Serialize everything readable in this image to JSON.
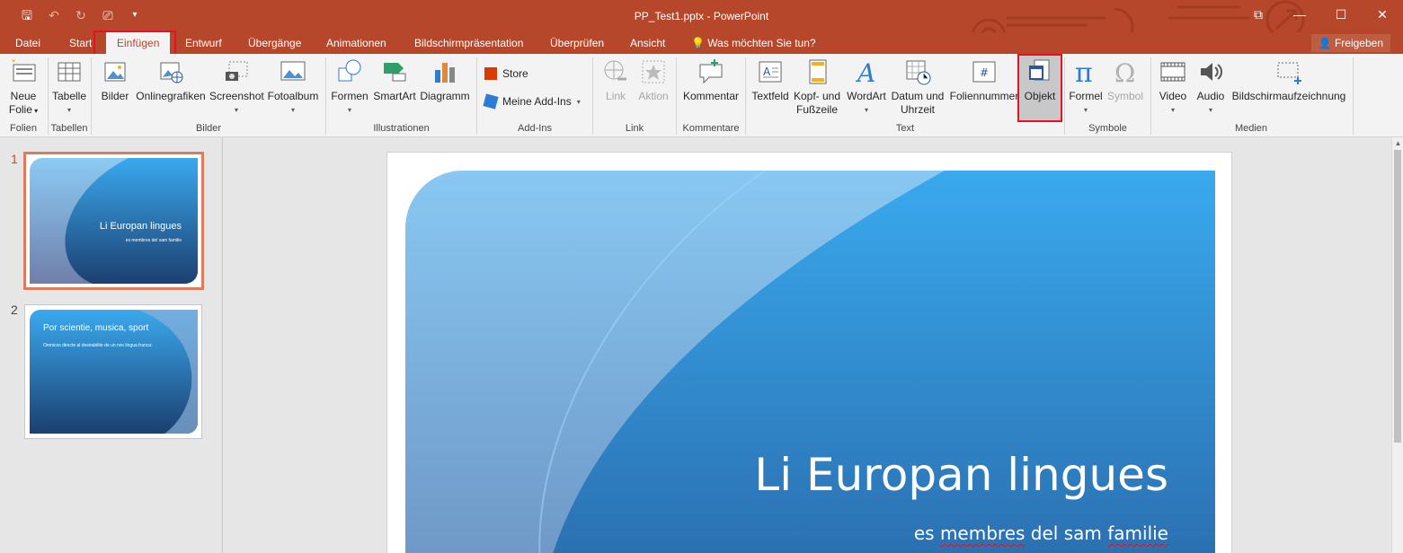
{
  "window": {
    "title": "PP_Test1.pptx - PowerPoint"
  },
  "tabs": [
    "Datei",
    "Start",
    "Einfügen",
    "Entwurf",
    "Übergänge",
    "Animationen",
    "Bildschirmpräsentation",
    "Überprüfen",
    "Ansicht"
  ],
  "active_tab": "Einfügen",
  "tell_me": "Was möchten Sie tun?",
  "share": "Freigeben",
  "ribbon": {
    "neue_folie": [
      "Neue",
      "Folie"
    ],
    "tabelle": "Tabelle",
    "bilder": "Bilder",
    "onlinegrafiken": "Onlinegrafiken",
    "screenshot": "Screenshot",
    "fotoalbum": "Fotoalbum",
    "formen": "Formen",
    "smartart": "SmartArt",
    "diagramm": "Diagramm",
    "store": "Store",
    "meine_addins": "Meine Add-Ins",
    "link": "Link",
    "aktion": "Aktion",
    "kommentar": "Kommentar",
    "textfeld": "Textfeld",
    "kopf_fusszeile": [
      "Kopf- und",
      "Fußzeile"
    ],
    "wordart": "WordArt",
    "datum_uhrzeit": [
      "Datum und",
      "Uhrzeit"
    ],
    "foliennummer": "Foliennummer",
    "objekt": "Objekt",
    "formel": "Formel",
    "symbol": "Symbol",
    "video": "Video",
    "audio": "Audio",
    "bildschirmaufzeichnung": "Bildschirmaufzeichnung",
    "groups": {
      "folien": "Folien",
      "tabellen": "Tabellen",
      "bilder": "Bilder",
      "illustrationen": "Illustrationen",
      "addins": "Add-Ins",
      "link": "Link",
      "kommentare": "Kommentare",
      "text": "Text",
      "symbole": "Symbole",
      "medien": "Medien"
    }
  },
  "thumbnails": [
    {
      "number": "1",
      "title": "Li Europan lingues",
      "subtitle": "es membres del sam familie"
    },
    {
      "number": "2",
      "title": "Por scientie, musica, sport",
      "subtitle": "Omnicos directe al desirabilite de un nov lingua franca:"
    }
  ],
  "slide": {
    "title": "Li Europan lingues",
    "subtitle_parts": [
      "es ",
      "membres",
      " del sam ",
      "familie"
    ]
  },
  "colors": {
    "accent": "#b7472a",
    "highlight": "#e81123",
    "slide_blue": "#2e8fd8"
  }
}
